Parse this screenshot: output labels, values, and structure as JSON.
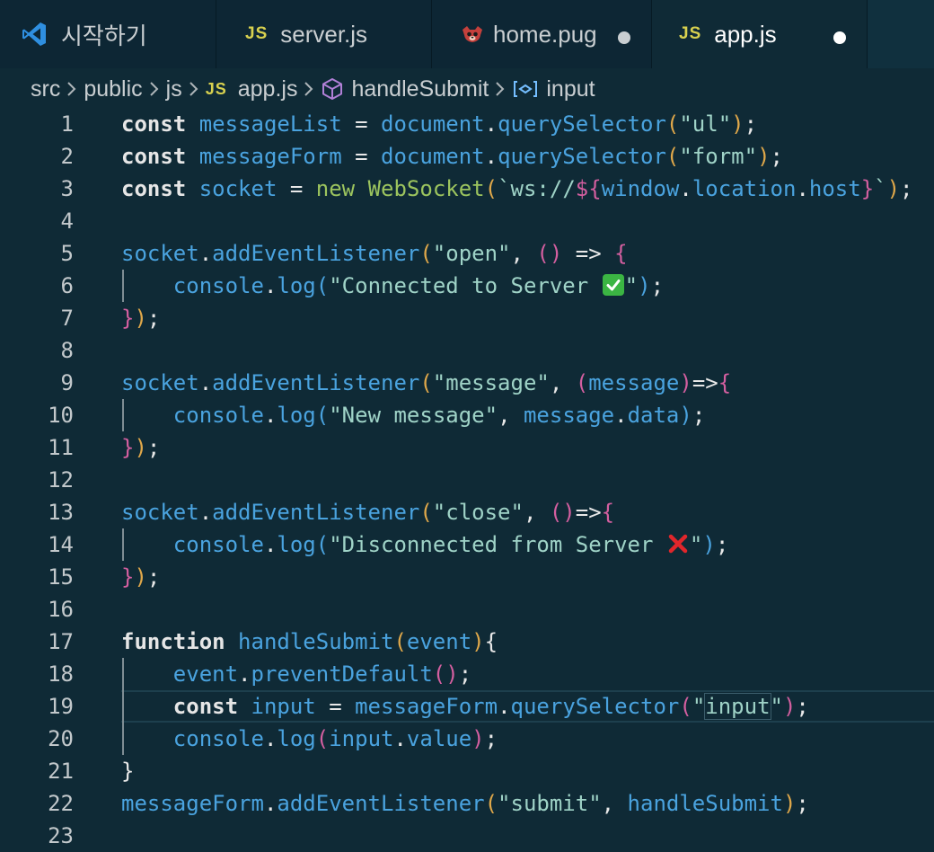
{
  "tabs": [
    {
      "label": "시작하기",
      "icon": "vscode-logo-icon",
      "active": false,
      "modified": false
    },
    {
      "label": "server.js",
      "icon": "js-file-icon",
      "icon_text": "JS",
      "active": false,
      "modified": false
    },
    {
      "label": "home.pug",
      "icon": "pug-file-icon",
      "active": false,
      "modified": true
    },
    {
      "label": "app.js",
      "icon": "js-file-icon",
      "icon_text": "JS",
      "active": true,
      "modified": true
    }
  ],
  "breadcrumb": {
    "items": [
      "src",
      "public",
      "js",
      "app.js",
      "handleSubmit",
      "input"
    ],
    "js_badge": "JS"
  },
  "colors": {
    "background": "#0f2a36",
    "tabbar": "#0b2230",
    "keyword": "#e6e6e6",
    "variable": "#4aa3df",
    "string": "#9fd3c7",
    "class": "#9cc45e",
    "bracket_gold": "#e0a84a",
    "bracket_pink": "#d45fa0"
  },
  "editor": {
    "current_line": 19,
    "line_numbers": [
      "1",
      "2",
      "3",
      "4",
      "5",
      "6",
      "7",
      "8",
      "9",
      "10",
      "11",
      "12",
      "13",
      "14",
      "15",
      "16",
      "17",
      "18",
      "19",
      "20",
      "21",
      "22",
      "23"
    ],
    "lines": [
      [
        [
          "kw",
          "const"
        ],
        [
          "plain",
          " "
        ],
        [
          "var",
          "messageList"
        ],
        [
          "op",
          " = "
        ],
        [
          "var",
          "document"
        ],
        [
          "punc",
          "."
        ],
        [
          "fn",
          "querySelector"
        ],
        [
          "p1",
          "("
        ],
        [
          "str",
          "\"ul\""
        ],
        [
          "p1",
          ")"
        ],
        [
          "punc",
          ";"
        ]
      ],
      [
        [
          "kw",
          "const"
        ],
        [
          "plain",
          " "
        ],
        [
          "var",
          "messageForm"
        ],
        [
          "op",
          " = "
        ],
        [
          "var",
          "document"
        ],
        [
          "punc",
          "."
        ],
        [
          "fn",
          "querySelector"
        ],
        [
          "p1",
          "("
        ],
        [
          "str",
          "\"form\""
        ],
        [
          "p1",
          ")"
        ],
        [
          "punc",
          ";"
        ]
      ],
      [
        [
          "kw",
          "const"
        ],
        [
          "plain",
          " "
        ],
        [
          "var",
          "socket"
        ],
        [
          "op",
          " = "
        ],
        [
          "new",
          "new"
        ],
        [
          "plain",
          " "
        ],
        [
          "cls",
          "WebSocket"
        ],
        [
          "p1",
          "("
        ],
        [
          "tpl",
          "`ws://"
        ],
        [
          "p2",
          "${"
        ],
        [
          "var",
          "window"
        ],
        [
          "punc",
          "."
        ],
        [
          "var",
          "location"
        ],
        [
          "punc",
          "."
        ],
        [
          "var",
          "host"
        ],
        [
          "p2",
          "}"
        ],
        [
          "tpl",
          "`"
        ],
        [
          "p1",
          ")"
        ],
        [
          "punc",
          ";"
        ]
      ],
      [],
      [
        [
          "var",
          "socket"
        ],
        [
          "punc",
          "."
        ],
        [
          "fn",
          "addEventListener"
        ],
        [
          "p1",
          "("
        ],
        [
          "str",
          "\"open\""
        ],
        [
          "punc",
          ", "
        ],
        [
          "p2",
          "()"
        ],
        [
          "op",
          " => "
        ],
        [
          "p2",
          "{"
        ]
      ],
      [
        [
          "plain",
          "    "
        ],
        [
          "var",
          "console"
        ],
        [
          "punc",
          "."
        ],
        [
          "fn",
          "log"
        ],
        [
          "p3",
          "("
        ],
        [
          "str",
          "\"Connected to Server "
        ],
        [
          "emoji",
          "check"
        ],
        [
          "str",
          "\""
        ],
        [
          "p3",
          ")"
        ],
        [
          "punc",
          ";"
        ]
      ],
      [
        [
          "p2",
          "}"
        ],
        [
          "p1",
          ")"
        ],
        [
          "punc",
          ";"
        ]
      ],
      [],
      [
        [
          "var",
          "socket"
        ],
        [
          "punc",
          "."
        ],
        [
          "fn",
          "addEventListener"
        ],
        [
          "p1",
          "("
        ],
        [
          "str",
          "\"message\""
        ],
        [
          "punc",
          ", "
        ],
        [
          "p2",
          "("
        ],
        [
          "var",
          "message"
        ],
        [
          "p2",
          ")"
        ],
        [
          "op",
          "=>"
        ],
        [
          "p2",
          "{"
        ]
      ],
      [
        [
          "plain",
          "    "
        ],
        [
          "var",
          "console"
        ],
        [
          "punc",
          "."
        ],
        [
          "fn",
          "log"
        ],
        [
          "p3",
          "("
        ],
        [
          "str",
          "\"New message\""
        ],
        [
          "punc",
          ", "
        ],
        [
          "var",
          "message"
        ],
        [
          "punc",
          "."
        ],
        [
          "var",
          "data"
        ],
        [
          "p3",
          ")"
        ],
        [
          "punc",
          ";"
        ]
      ],
      [
        [
          "p2",
          "}"
        ],
        [
          "p1",
          ")"
        ],
        [
          "punc",
          ";"
        ]
      ],
      [],
      [
        [
          "var",
          "socket"
        ],
        [
          "punc",
          "."
        ],
        [
          "fn",
          "addEventListener"
        ],
        [
          "p1",
          "("
        ],
        [
          "str",
          "\"close\""
        ],
        [
          "punc",
          ", "
        ],
        [
          "p2",
          "()"
        ],
        [
          "op",
          "=>"
        ],
        [
          "p2",
          "{"
        ]
      ],
      [
        [
          "plain",
          "    "
        ],
        [
          "var",
          "console"
        ],
        [
          "punc",
          "."
        ],
        [
          "fn",
          "log"
        ],
        [
          "p3",
          "("
        ],
        [
          "str",
          "\"Disconnected from Server "
        ],
        [
          "emoji",
          "cross"
        ],
        [
          "str",
          "\""
        ],
        [
          "p3",
          ")"
        ],
        [
          "punc",
          ";"
        ]
      ],
      [
        [
          "p2",
          "}"
        ],
        [
          "p1",
          ")"
        ],
        [
          "punc",
          ";"
        ]
      ],
      [],
      [
        [
          "kw",
          "function"
        ],
        [
          "plain",
          " "
        ],
        [
          "fn",
          "handleSubmit"
        ],
        [
          "p1",
          "("
        ],
        [
          "var",
          "event"
        ],
        [
          "p1",
          ")"
        ],
        [
          "plain",
          "{"
        ]
      ],
      [
        [
          "plain",
          "    "
        ],
        [
          "var",
          "event"
        ],
        [
          "punc",
          "."
        ],
        [
          "fn",
          "preventDefault"
        ],
        [
          "p2",
          "()"
        ],
        [
          "punc",
          ";"
        ]
      ],
      [
        [
          "plain",
          "    "
        ],
        [
          "kw",
          "const"
        ],
        [
          "plain",
          " "
        ],
        [
          "var",
          "input"
        ],
        [
          "op",
          " = "
        ],
        [
          "var",
          "messageForm"
        ],
        [
          "punc",
          "."
        ],
        [
          "fn",
          "querySelector"
        ],
        [
          "p2",
          "("
        ],
        [
          "str",
          "\""
        ],
        [
          "strm",
          "input"
        ],
        [
          "str",
          "\""
        ],
        [
          "p2",
          ")"
        ],
        [
          "punc",
          ";"
        ]
      ],
      [
        [
          "plain",
          "    "
        ],
        [
          "var",
          "console"
        ],
        [
          "punc",
          "."
        ],
        [
          "fn",
          "log"
        ],
        [
          "p2",
          "("
        ],
        [
          "var",
          "input"
        ],
        [
          "punc",
          "."
        ],
        [
          "var",
          "value"
        ],
        [
          "p2",
          ")"
        ],
        [
          "punc",
          ";"
        ]
      ],
      [
        [
          "plain",
          "}"
        ]
      ],
      [
        [
          "var",
          "messageForm"
        ],
        [
          "punc",
          "."
        ],
        [
          "fn",
          "addEventListener"
        ],
        [
          "p1",
          "("
        ],
        [
          "str",
          "\"submit\""
        ],
        [
          "punc",
          ", "
        ],
        [
          "var",
          "handleSubmit"
        ],
        [
          "p1",
          ")"
        ],
        [
          "punc",
          ";"
        ]
      ],
      []
    ]
  }
}
